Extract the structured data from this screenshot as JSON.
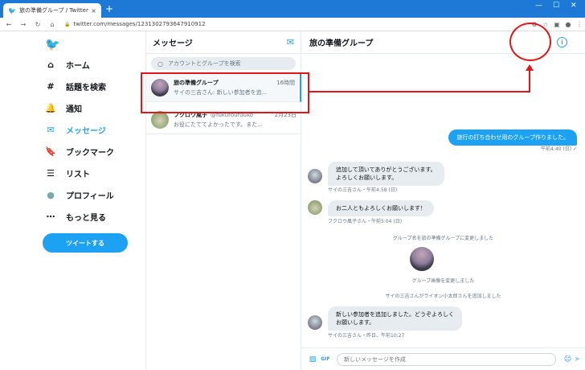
{
  "browser": {
    "tab_title": "旅の準備グループ / Twitter",
    "url": "twitter.com/messages/1231302793647910912",
    "new_tab": "+",
    "close": "×",
    "minimize": "—",
    "maximize": "☐",
    "close_window": "✕"
  },
  "nav": {
    "items": [
      {
        "label": "ホーム",
        "icon": "⌂"
      },
      {
        "label": "話題を検索",
        "icon": "#"
      },
      {
        "label": "通知",
        "icon": "🔔"
      },
      {
        "label": "メッセージ",
        "icon": "✉"
      },
      {
        "label": "ブックマーク",
        "icon": "🔖"
      },
      {
        "label": "リスト",
        "icon": "☰"
      },
      {
        "label": "プロフィール",
        "icon": "●"
      },
      {
        "label": "もっと見る",
        "icon": "⋯"
      }
    ],
    "tweet_button": "ツイートする"
  },
  "messages": {
    "title": "メッセージ",
    "search_placeholder": "アカウントとグループを検索",
    "conversations": [
      {
        "name": "旅の準備グループ",
        "handle": "",
        "time": "16時間",
        "preview": "サイの三吉さん: 新しい参加者を追..."
      },
      {
        "name": "フクロウ風子",
        "handle": "@fukuroufuuko",
        "time": "2月23日",
        "preview": "お役にたててよかったです。また..."
      }
    ]
  },
  "conversation": {
    "title": "旅の準備グループ",
    "outgoing": {
      "text": "旅行の打ち合わせ用のグループ作りました。",
      "meta": "午前4:40 (日) ✓"
    },
    "msg1": {
      "text1": "追加して頂いてありがとうございます。",
      "text2": "よろしくお願いします。",
      "meta": "サイの三吉さん・午前4:58 (日)"
    },
    "msg2": {
      "text": "お二人ともよろしくお願いします！",
      "meta": "フクロウ風子さん・午前5:04 (日)"
    },
    "sys1": "グループ名を旅の準備グループに変更しました",
    "sys2": "グループ画像を変更しました",
    "sys3": "サイの三吉さんがライオン小太郎さんを追加しました",
    "msg3": {
      "text1": "新しい参加者を追加しました。どうぞよろしく",
      "text2": "お願いします。",
      "meta": "サイの三吉さん・昨日、午前10:27"
    },
    "composer_placeholder": "新しいメッセージを作成"
  },
  "colors": {
    "accent": "#1da1f2",
    "annotation": "#e0161a",
    "chrome": "#1e79d6"
  }
}
